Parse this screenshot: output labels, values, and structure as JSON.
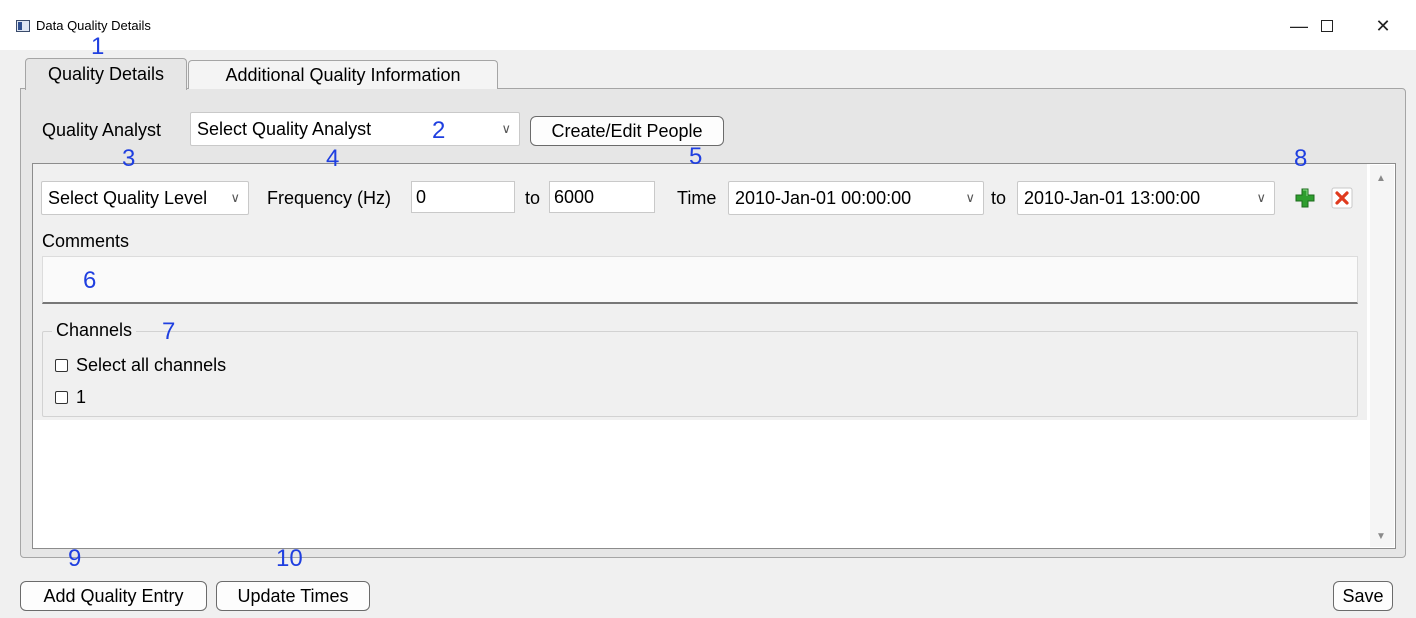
{
  "window": {
    "title": "Data Quality Details",
    "minimize_glyph": "—",
    "close_glyph": "✕",
    "app_icon": "window-app-icon"
  },
  "tabs": [
    {
      "label": "Quality Details",
      "active": true
    },
    {
      "label": "Additional Quality Information",
      "active": false
    }
  ],
  "analyst": {
    "label": "Quality Analyst",
    "selected": "Select Quality Analyst",
    "create_button": "Create/Edit People"
  },
  "entry": {
    "quality_level": "Select Quality Level",
    "frequency_label": "Frequency (Hz)",
    "frequency_from": "0",
    "to_label": "to",
    "frequency_to": "6000",
    "time_label": "Time",
    "time_from": "2010-Jan-01 00:00:00",
    "time_to": "2010-Jan-01 13:00:00",
    "comments_label": "Comments",
    "comments_value": "",
    "channels_label": "Channels",
    "select_all_label": "Select all channels",
    "channel_items": [
      "1"
    ]
  },
  "annotations": [
    "1",
    "2",
    "3",
    "4",
    "5",
    "6",
    "7",
    "8",
    "9",
    "10"
  ],
  "footer": {
    "add_entry_button": "Add Quality Entry",
    "update_times_button": "Update Times",
    "save_button": "Save"
  },
  "colors": {
    "annotation": "#1f3fe0",
    "add_icon": "#2e9e2e",
    "delete_icon": "#e03a1e"
  },
  "icons": [
    "chevron-down-icon",
    "add-entry-icon",
    "delete-entry-icon",
    "scroll-up-icon",
    "scroll-down-icon"
  ]
}
